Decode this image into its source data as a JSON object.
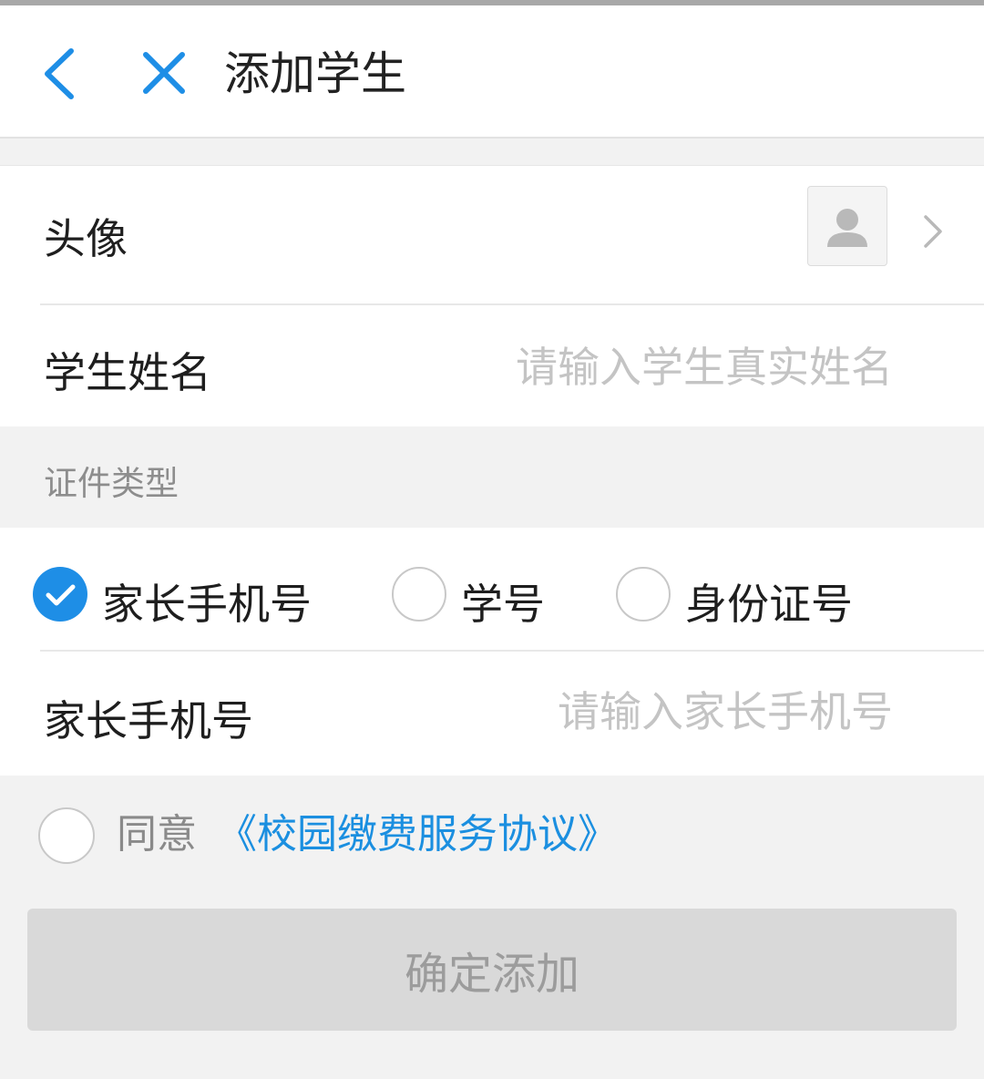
{
  "header": {
    "title": "添加学生",
    "back_icon": "chevron-left-icon",
    "close_icon": "close-icon"
  },
  "form": {
    "avatar": {
      "label": "头像",
      "icon": "user-placeholder-icon"
    },
    "student_name": {
      "label": "学生姓名",
      "value": "",
      "placeholder": "请输入学生真实姓名"
    },
    "id_type": {
      "section_label": "证件类型",
      "options": [
        {
          "label": "家长手机号",
          "selected": true
        },
        {
          "label": "学号",
          "selected": false
        },
        {
          "label": "身份证号",
          "selected": false
        }
      ]
    },
    "parent_phone": {
      "label": "家长手机号",
      "value": "",
      "placeholder": "请输入家长手机号"
    }
  },
  "agreement": {
    "checked": false,
    "prefix": "同意",
    "link_text": "《校园缴费服务协议》"
  },
  "confirm_button": {
    "label": "确定添加",
    "enabled": false
  },
  "colors": {
    "accent": "#1e8ee6",
    "link": "#1b8fe0",
    "disabled_button_bg": "#d9d9d9",
    "disabled_button_text": "#9c9c9c",
    "page_bg": "#f2f2f2"
  }
}
